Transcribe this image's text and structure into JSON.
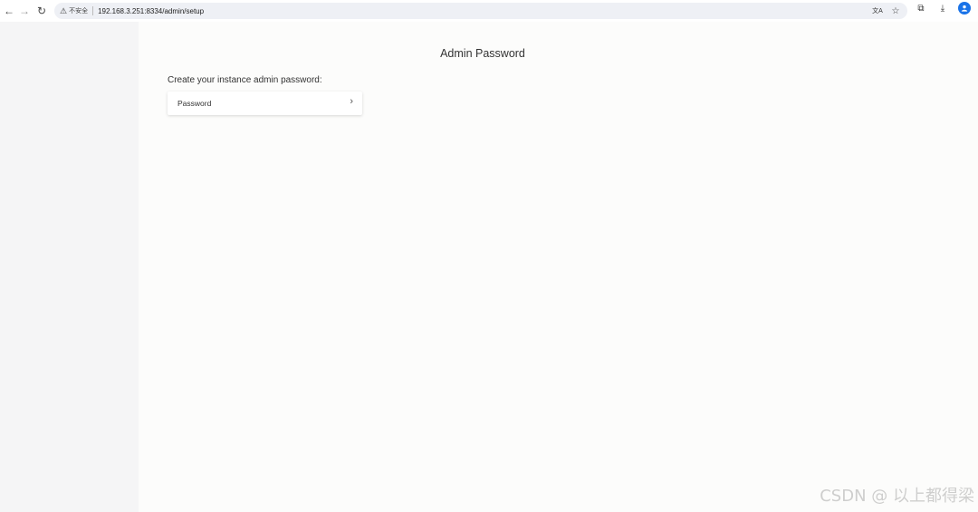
{
  "browser": {
    "security_label": "不安全",
    "url": "192.168.3.251:8334/admin/setup"
  },
  "page": {
    "title": "Admin Password",
    "prompt": "Create your instance admin password:",
    "password_item_label": "Password"
  },
  "watermark": "CSDN @ 以上都得梁",
  "icons": {
    "back": "←",
    "forward": "→",
    "reload": "↻",
    "warning": "⚠",
    "translate": "文A",
    "star": "☆",
    "extensions": "⧉",
    "download": "⤓",
    "profile": "●",
    "chevron": "›"
  }
}
